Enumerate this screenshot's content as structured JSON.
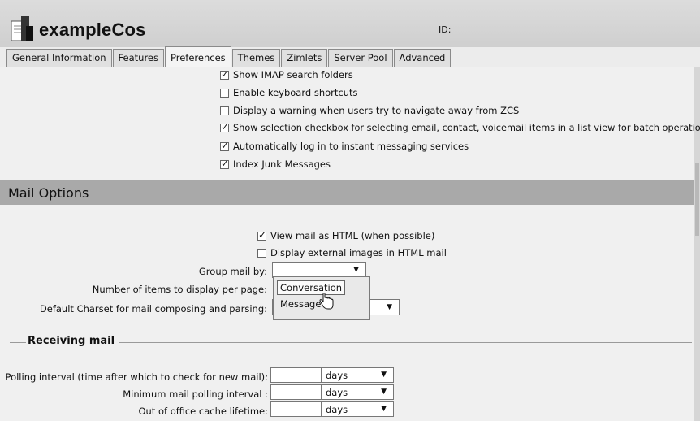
{
  "header": {
    "title": "exampleCos",
    "id_label": "ID:"
  },
  "tabs": [
    {
      "label": "General Information"
    },
    {
      "label": "Features"
    },
    {
      "label": "Preferences"
    },
    {
      "label": "Themes"
    },
    {
      "label": "Zimlets"
    },
    {
      "label": "Server Pool"
    },
    {
      "label": "Advanced"
    }
  ],
  "active_tab": "Preferences",
  "general_options": [
    {
      "label": "Show IMAP search folders",
      "checked": true
    },
    {
      "label": "Enable keyboard shortcuts",
      "checked": false
    },
    {
      "label": "Display a warning when users try to navigate away from ZCS",
      "checked": false
    },
    {
      "label": "Show selection checkbox for selecting email, contact, voicemail items in a list view for batch operations",
      "checked": true
    },
    {
      "label": "Automatically log in to instant messaging services",
      "checked": true
    },
    {
      "label": "Index Junk Messages",
      "checked": true
    }
  ],
  "mail_options": {
    "title": "Mail Options",
    "view_html": {
      "label": "View mail as HTML (when possible)",
      "checked": true
    },
    "external_images": {
      "label": "Display external images in HTML mail",
      "checked": false
    },
    "group_by_label": "Group mail by:",
    "items_per_page_label": "Number of items to display per page:",
    "charset_label": "Default Charset for mail composing and parsing:",
    "group_by_options": [
      "Conversation",
      "Message"
    ]
  },
  "receiving": {
    "title": "Receiving mail",
    "rows": [
      {
        "label": "Polling interval (time after which to check for new mail):",
        "value": "",
        "unit": "days"
      },
      {
        "label": "Minimum mail polling interval :",
        "value": "",
        "unit": "days"
      },
      {
        "label": "Out of office cache lifetime:",
        "value": "",
        "unit": "days"
      }
    ]
  },
  "colors": {
    "section_header": "#a9a9a9",
    "background": "#f0f0f0"
  }
}
